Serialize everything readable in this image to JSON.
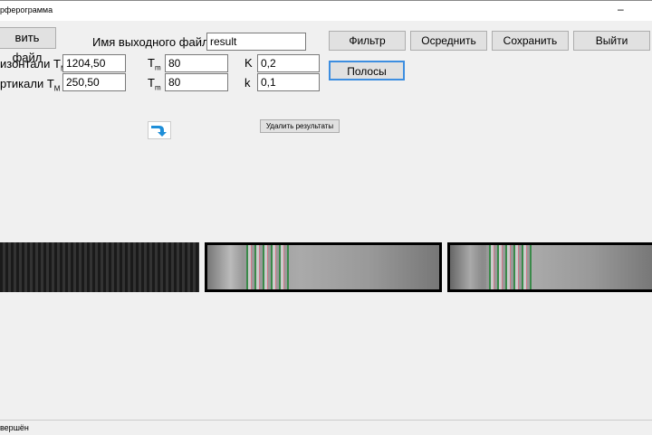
{
  "window": {
    "title": "рферограмма",
    "minimize": "–"
  },
  "buttons": {
    "open": "вить файл",
    "filter": "Фильтр",
    "average": "Осреднить",
    "save": "Сохранить",
    "exit": "Выйти",
    "stripes": "Полосы",
    "delete_results": "Удалить результаты"
  },
  "output": {
    "label": "Имя выходного файла",
    "value": "result"
  },
  "row1": {
    "label": "изонтали Т",
    "sub": "М",
    "value": "1204,50",
    "t_label": "T",
    "t_sub": "m",
    "t_value": "80",
    "k_label": "K",
    "k_value": "0,2"
  },
  "row2": {
    "label": "ртикали Т",
    "sub": "М",
    "value": "250,50",
    "t_label": "T",
    "t_sub": "m",
    "t_value": "80",
    "k_label": "k",
    "k_value": "0,1"
  },
  "status": "вершён"
}
